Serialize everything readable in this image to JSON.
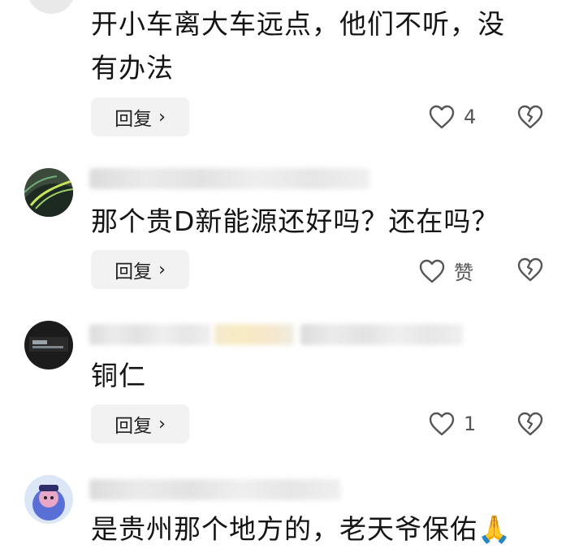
{
  "comments": [
    {
      "text_lines": [
        "开小车离大车远点，他们不听，没",
        "有办法"
      ],
      "reply_label": "回复",
      "like_text": "4"
    },
    {
      "text_lines": [
        "那个贵D新能源还好吗？还在吗？"
      ],
      "reply_label": "回复",
      "like_text": "赞"
    },
    {
      "text_lines": [
        "铜仁"
      ],
      "reply_label": "回复",
      "like_text": "1"
    },
    {
      "text_lines": [
        "是贵州那个地方的，老天爷保佑🙏"
      ]
    }
  ],
  "icons": {
    "like": "heart-outline-icon",
    "dislike": "broken-heart-icon",
    "reply_chevron": "chevron-right-icon"
  },
  "colors": {
    "reply_bg": "#f2f2f2",
    "text": "#141414",
    "icon": "#555555"
  }
}
